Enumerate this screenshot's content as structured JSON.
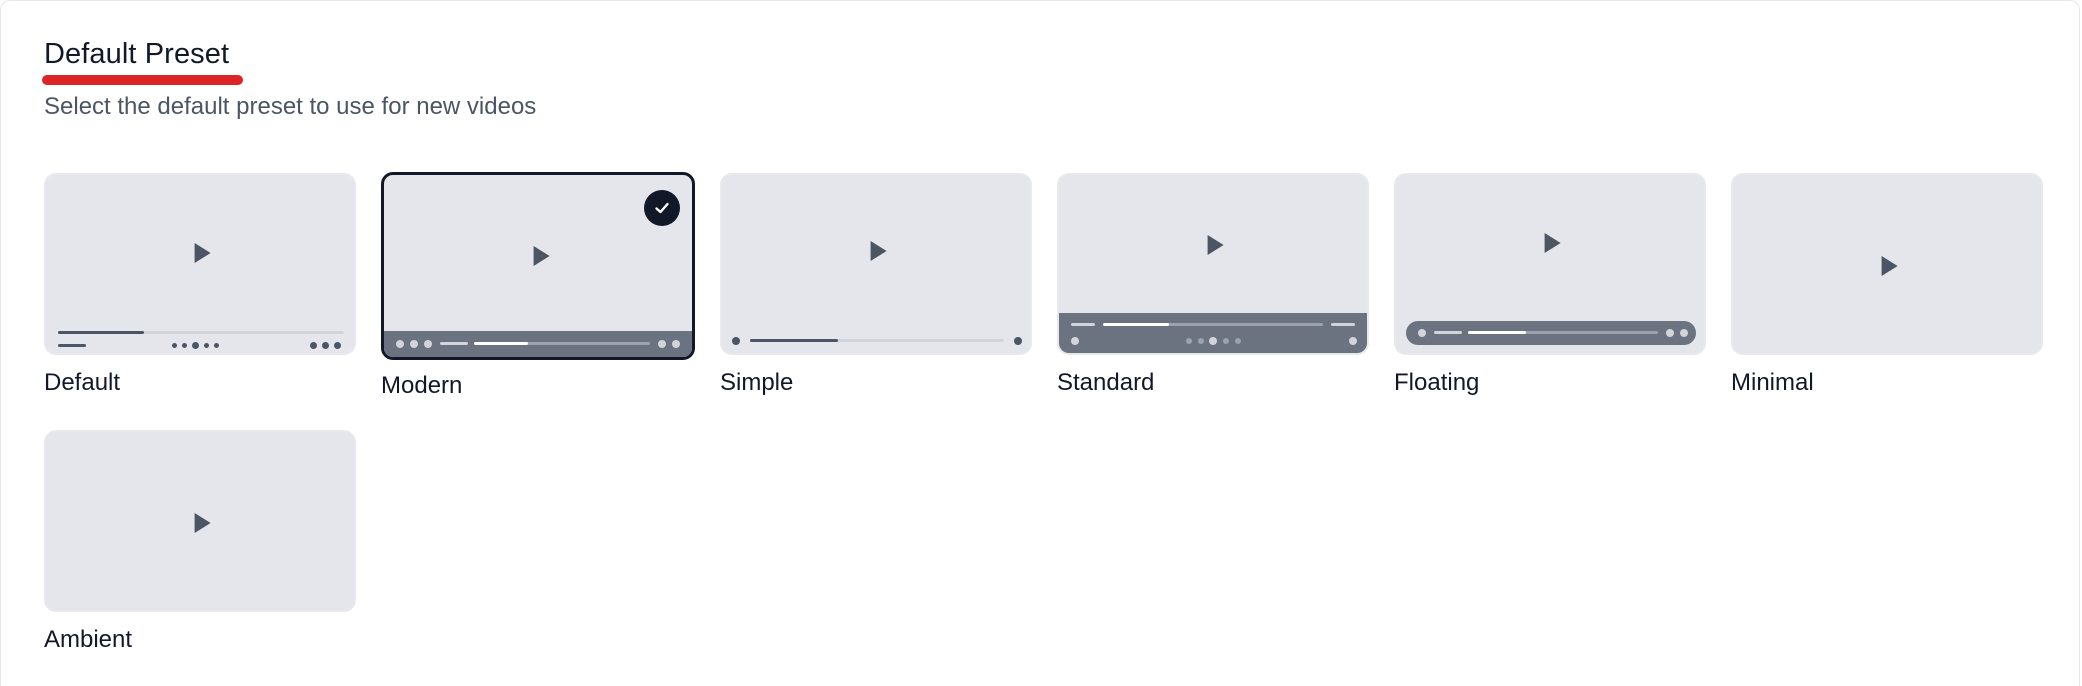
{
  "section": {
    "title": "Default Preset",
    "subtitle": "Select the default preset to use for new videos"
  },
  "presets": [
    {
      "label": "Default",
      "selected": false
    },
    {
      "label": "Modern",
      "selected": true
    },
    {
      "label": "Simple",
      "selected": false
    },
    {
      "label": "Standard",
      "selected": false
    },
    {
      "label": "Floating",
      "selected": false
    },
    {
      "label": "Minimal",
      "selected": false
    },
    {
      "label": "Ambient",
      "selected": false
    }
  ],
  "icons": {
    "preview_play": "play-icon",
    "selected_indicator": "checkmark-icon"
  },
  "colors": {
    "accent_underline": "#dc2626",
    "thumbnail_bg": "#e5e6eb",
    "control_bar": "#6b7280",
    "selected_border": "#111827"
  }
}
